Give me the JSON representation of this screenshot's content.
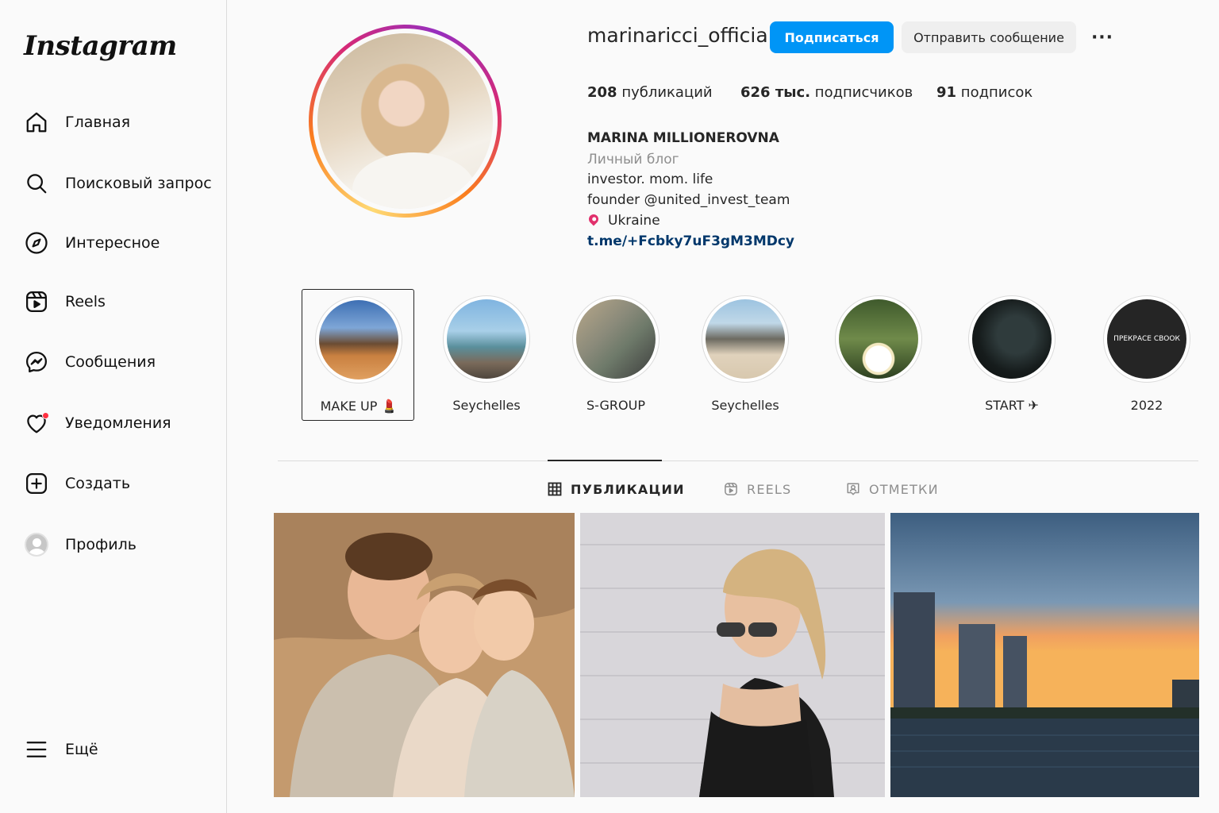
{
  "app": {
    "logo": "Instagram"
  },
  "sidebar": {
    "items": [
      {
        "label": "Главная",
        "icon": "home-icon"
      },
      {
        "label": "Поисковый запрос",
        "icon": "search-icon"
      },
      {
        "label": "Интересное",
        "icon": "compass-icon"
      },
      {
        "label": "Reels",
        "icon": "reels-icon"
      },
      {
        "label": "Сообщения",
        "icon": "messenger-icon"
      },
      {
        "label": "Уведомления",
        "icon": "heart-icon"
      },
      {
        "label": "Создать",
        "icon": "plus-square-icon"
      },
      {
        "label": "Профиль",
        "icon": "avatar-icon"
      }
    ],
    "more_label": "Ещё"
  },
  "profile": {
    "username": "marinaricci_official",
    "follow_label": "Подписаться",
    "message_label": "Отправить сообщение",
    "more_label": "···",
    "stats": {
      "posts_count": "208",
      "posts_label": "публикаций",
      "followers_count": "626 тыс.",
      "followers_label": "подписчиков",
      "following_count": "91",
      "following_label": "подписок"
    },
    "bio": {
      "name": "MARINA MILLIONEROVNA",
      "category": "Личный блог",
      "line1": "investor. mom. life",
      "line2": "founder @united_invest_team",
      "location": "Ukraine",
      "link": "t.me/+Fcbky7uF3gM3MDcy"
    }
  },
  "highlights": [
    {
      "label": "MAKE UP 💄"
    },
    {
      "label": "Seychelles"
    },
    {
      "label": "S-GROUP"
    },
    {
      "label": "Seychelles"
    },
    {
      "label": ""
    },
    {
      "label": "START ✈"
    },
    {
      "label": "2022",
      "cover_text": "ПРЕКРАСЕ СВООК"
    }
  ],
  "tabs": [
    {
      "label": "ПУБЛИКАЦИИ"
    },
    {
      "label": "REELS"
    },
    {
      "label": "ОТМЕТКИ"
    }
  ],
  "colors": {
    "accent": "#0095f6",
    "link": "#00376b",
    "notification": "#ff3040"
  }
}
